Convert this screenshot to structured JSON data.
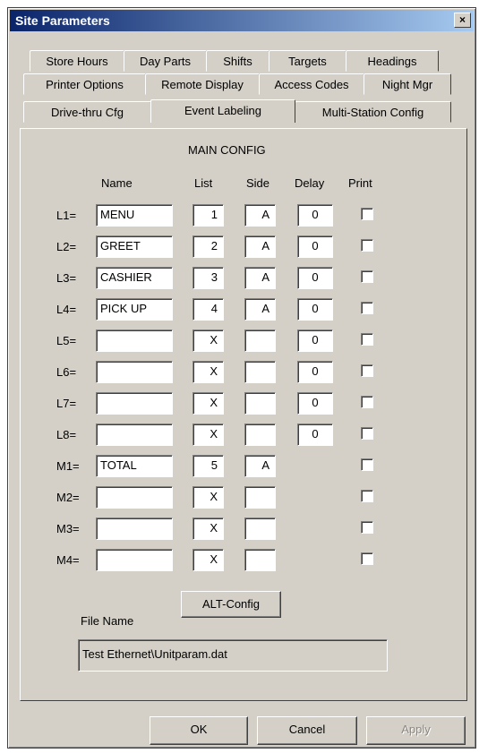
{
  "window": {
    "title": "Site Parameters",
    "close_label": "×"
  },
  "tabs": {
    "row1": [
      "Store Hours",
      "Day Parts",
      "Shifts",
      "Targets",
      "Headings"
    ],
    "row2": [
      "Printer Options",
      "Remote Display",
      "Access Codes",
      "Night Mgr"
    ],
    "row3": [
      "Drive-thru Cfg",
      "Event Labeling",
      "Multi-Station Config"
    ],
    "active": "Event Labeling"
  },
  "main_config": {
    "title": "MAIN CONFIG",
    "headers": {
      "name": "Name",
      "list": "List",
      "side": "Side",
      "delay": "Delay",
      "print": "Print"
    },
    "rows": [
      {
        "label": "L1=",
        "name": "MENU",
        "list": "1",
        "side": "A",
        "delay": "0",
        "print": false
      },
      {
        "label": "L2=",
        "name": "GREET",
        "list": "2",
        "side": "A",
        "delay": "0",
        "print": false
      },
      {
        "label": "L3=",
        "name": "CASHIER",
        "list": "3",
        "side": "A",
        "delay": "0",
        "print": false
      },
      {
        "label": "L4=",
        "name": "PICK UP",
        "list": "4",
        "side": "A",
        "delay": "0",
        "print": false
      },
      {
        "label": "L5=",
        "name": "",
        "list": "X",
        "side": "",
        "delay": "0",
        "print": false
      },
      {
        "label": "L6=",
        "name": "",
        "list": "X",
        "side": "",
        "delay": "0",
        "print": false
      },
      {
        "label": "L7=",
        "name": "",
        "list": "X",
        "side": "",
        "delay": "0",
        "print": false
      },
      {
        "label": "L8=",
        "name": "",
        "list": "X",
        "side": "",
        "delay": "0",
        "print": false
      },
      {
        "label": "M1=",
        "name": "TOTAL",
        "list": "5",
        "side": "A",
        "print": false
      },
      {
        "label": "M2=",
        "name": "",
        "list": "X",
        "side": "",
        "print": false
      },
      {
        "label": "M3=",
        "name": "",
        "list": "X",
        "side": "",
        "print": false
      },
      {
        "label": "M4=",
        "name": "",
        "list": "X",
        "side": "",
        "print": false
      }
    ]
  },
  "alt_config_label": "ALT-Config",
  "file": {
    "label": "File Name",
    "value": "Test Ethernet\\Unitparam.dat"
  },
  "footer": {
    "ok_label": "OK",
    "cancel_label": "Cancel",
    "apply_label": "Apply"
  },
  "colors": {
    "dialog_bg": "#d4d0c8",
    "title_start": "#0a246a",
    "title_end": "#a6caf0"
  }
}
